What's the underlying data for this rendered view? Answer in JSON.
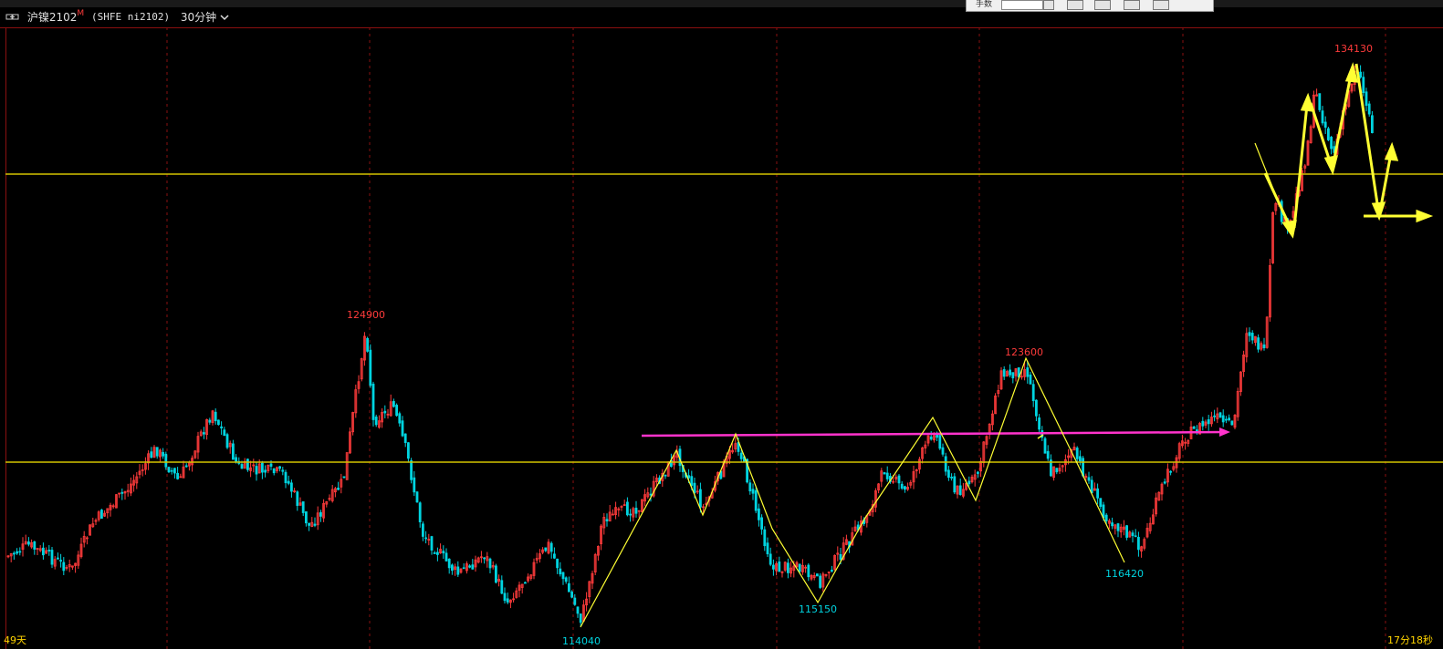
{
  "header": {
    "symbol_icon": "link-icon",
    "symbol_name": "沪镍2102",
    "symbol_flag": "M",
    "symbol_code": "(SHFE ni2102)",
    "period": "30分钟",
    "period_icon": "chevron-down-icon"
  },
  "toolbar": {
    "label": "手数"
  },
  "footer": {
    "left_label": "49天",
    "right_label": "17分18秒"
  },
  "colors": {
    "up": "#ff3b3b",
    "down": "#00d4e0",
    "horizontal_line": "#d4c400",
    "zigzag": "#ffff33",
    "pink_line": "#ff33cc",
    "grid": "#8a1010"
  },
  "chart_data": {
    "type": "candlestick",
    "horizontal_levels": [
      132000,
      120000
    ],
    "y_range_approx": [
      113500,
      136000
    ],
    "annotations": [
      {
        "label": "124900",
        "kind": "high"
      },
      {
        "label": "123600",
        "kind": "high"
      },
      {
        "label": "134130",
        "kind": "high"
      },
      {
        "label": "114040",
        "kind": "low"
      },
      {
        "label": "115150",
        "kind": "low"
      },
      {
        "label": "116420",
        "kind": "low"
      }
    ],
    "pink_resistance_line": true,
    "zigzag": true
  }
}
